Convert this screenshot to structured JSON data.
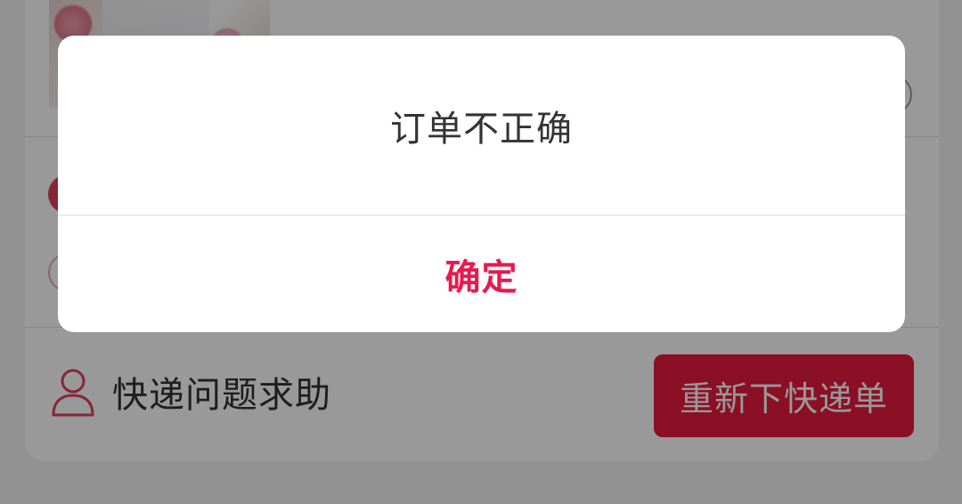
{
  "background": {
    "help_label": "快递问题求助",
    "reorder_button_label": "重新下快递单",
    "icons": {
      "help": "user-outline-icon"
    },
    "colors": {
      "accent": "#e8193f",
      "radio_selected": "#e0405e"
    }
  },
  "dialog": {
    "message": "订单不正确",
    "confirm_label": "确定",
    "colors": {
      "confirm_text": "#e8194f",
      "mask": "rgba(0,0,0,0.4)"
    }
  }
}
